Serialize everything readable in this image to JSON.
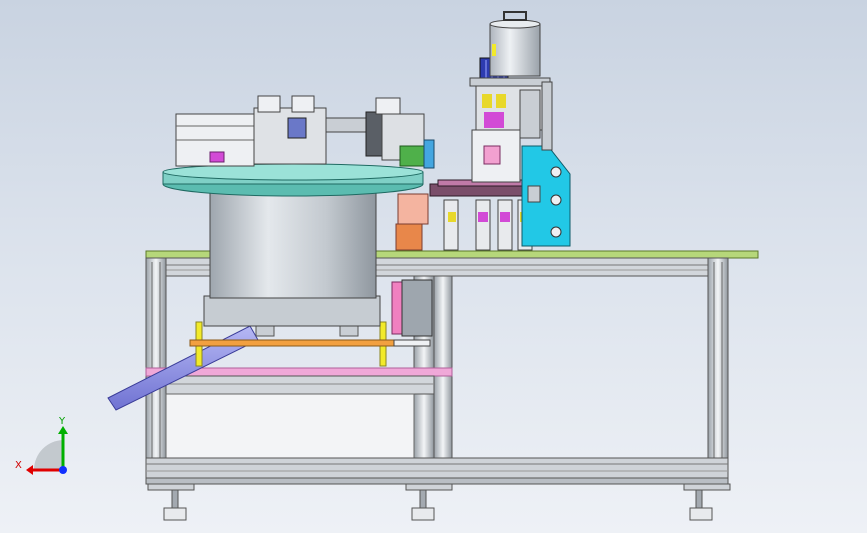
{
  "viewport": {
    "name": "cad-graphics-area",
    "background_top": "#c9d3e1",
    "background_bottom": "#eef1f6"
  },
  "triad": {
    "x_label": "X",
    "y_label": "Y",
    "x_color": "#e00000",
    "y_color": "#00b000",
    "z_color": "#1030ff"
  },
  "model": {
    "frame_color": "#c7ccd2",
    "table_top_color": "#b6d77a",
    "bowl_color": "#c9ced4",
    "bowl_rim_color": "#5bbcb0",
    "cyan_bracket_color": "#22c8e6",
    "pink_rail_color": "#f0a8d8",
    "yellow_post_color": "#f2ea2a",
    "orange_bar_color": "#f2a040",
    "blue_tube_color": "#8b8ee8"
  }
}
